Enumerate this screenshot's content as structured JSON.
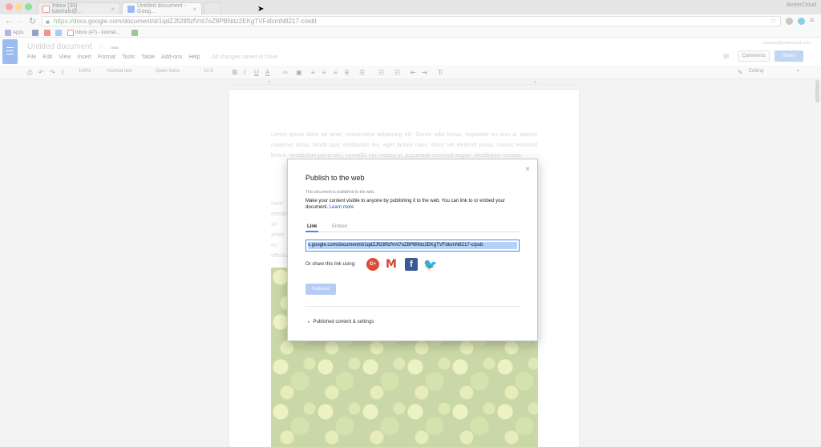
{
  "browser": {
    "tabs": [
      {
        "label": "Inbox (30) - tutorials@..."
      },
      {
        "label": "Untitled document - Goog..."
      }
    ],
    "profile": "BetterCloud",
    "url_scheme": "https://",
    "url_rest": "docs.google.com/document/d/1qdZJfi28flzfVnt7oZ8PBNitz2EKgTVFdlcmN8217-c/edit",
    "bookmarks": [
      "Apps",
      "Inbox (47) - tutorial..."
    ]
  },
  "docs": {
    "title": "Untitled document",
    "menu": [
      "File",
      "Edit",
      "View",
      "Insert",
      "Format",
      "Tools",
      "Table",
      "Add-ons",
      "Help"
    ],
    "saved_status": "All changes saved in Drive",
    "account": "tutorials@bettercloud.com",
    "comments_label": "Comments",
    "share_label": "Share",
    "toolbar": {
      "zoom": "100%",
      "style": "Normal text",
      "font": "Open Sans",
      "size": "10.5",
      "mode": "Editing"
    }
  },
  "document": {
    "paragraph1": "Lorem ipsum dolor sit amet, consectetur adipiscing elit. Donec odio lectus, imperdiet eu arcu a, laoreet maximus lacus. Morbi quis vestibulum leo, eget lacinia nunc. Nunc vel eleifend purus, cursus euismod lectus. Vestibulum purus orci, convallis nec massa ut, accumsan euismod augue. Vestibulum semper.",
    "paragraph2": "Nam elementum sit amet eu efficitur venenatis."
  },
  "dialog": {
    "title": "Publish to the web",
    "status": "This document is published to the web.",
    "description": "Make your content visible to anyone by publishing it to the web. You can link to or embed your document.",
    "learn_more": "Learn more",
    "tab_link": "Link",
    "tab_embed": "Embed",
    "link_value": "s.google.com/document/d/1qdZJfi28flzfVnt7oZ8PBNitz2EKgTVFdlcmN8217-c/pub",
    "share_label": "Or share this link using:",
    "published_button": "Published",
    "settings_label": "Published content & settings",
    "close": "×"
  },
  "colors": {
    "accent": "#4a86e8",
    "gplus": "#dd4b39",
    "facebook": "#3b5998",
    "twitter": "#55acee"
  }
}
